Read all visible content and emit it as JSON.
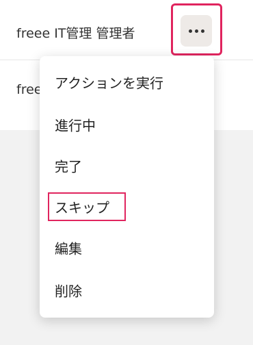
{
  "list": {
    "rows": [
      {
        "text": "freee IT管理 管理者"
      },
      {
        "text": "free"
      }
    ]
  },
  "more_button": {
    "icon": "more-horizontal-icon"
  },
  "menu": {
    "items": [
      {
        "label": "アクションを実行"
      },
      {
        "label": "進行中"
      },
      {
        "label": "完了"
      },
      {
        "label": "スキップ"
      },
      {
        "label": "編集"
      },
      {
        "label": "削除"
      }
    ]
  },
  "colors": {
    "highlight": "#e0245e",
    "more_button_bg": "#eeeae7",
    "page_bg": "#f2f2f2"
  }
}
